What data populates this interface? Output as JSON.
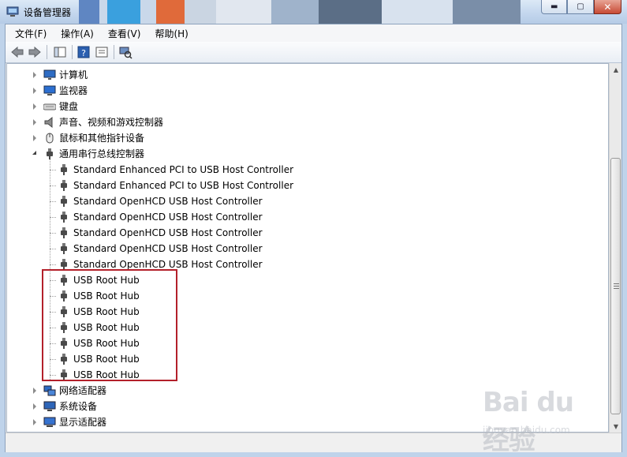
{
  "window": {
    "title": "设备管理器",
    "controls": {
      "minimize": "▬",
      "maximize": "▢",
      "close": "✕"
    }
  },
  "menubar": [
    {
      "label": "文件(F)"
    },
    {
      "label": "操作(A)"
    },
    {
      "label": "查看(V)"
    },
    {
      "label": "帮助(H)"
    }
  ],
  "tree": {
    "categories_before": [
      {
        "label": "计算机",
        "icon": "computer-icon"
      },
      {
        "label": "监视器",
        "icon": "monitor-icon"
      },
      {
        "label": "键盘",
        "icon": "keyboard-icon"
      },
      {
        "label": "声音、视频和游戏控制器",
        "icon": "speaker-icon"
      },
      {
        "label": "鼠标和其他指针设备",
        "icon": "mouse-icon"
      }
    ],
    "expanded": {
      "label": "通用串行总线控制器",
      "icon": "usb-icon",
      "children": [
        {
          "label": "Standard Enhanced PCI to USB Host Controller"
        },
        {
          "label": "Standard Enhanced PCI to USB Host Controller"
        },
        {
          "label": "Standard OpenHCD USB Host Controller"
        },
        {
          "label": "Standard OpenHCD USB Host Controller"
        },
        {
          "label": "Standard OpenHCD USB Host Controller"
        },
        {
          "label": "Standard OpenHCD USB Host Controller"
        },
        {
          "label": "Standard OpenHCD USB Host Controller"
        },
        {
          "label": "USB Root Hub"
        },
        {
          "label": "USB Root Hub"
        },
        {
          "label": "USB Root Hub"
        },
        {
          "label": "USB Root Hub"
        },
        {
          "label": "USB Root Hub"
        },
        {
          "label": "USB Root Hub"
        },
        {
          "label": "USB Root Hub"
        }
      ]
    },
    "categories_after": [
      {
        "label": "网络适配器",
        "icon": "network-icon"
      },
      {
        "label": "系统设备",
        "icon": "system-icon"
      },
      {
        "label": "显示适配器",
        "icon": "display-adapter-icon"
      }
    ]
  },
  "watermark": {
    "logo": "Bai du 经验",
    "sub": "jingyan.baidu.com"
  },
  "colors": {
    "highlight_border": "#b3202a"
  }
}
